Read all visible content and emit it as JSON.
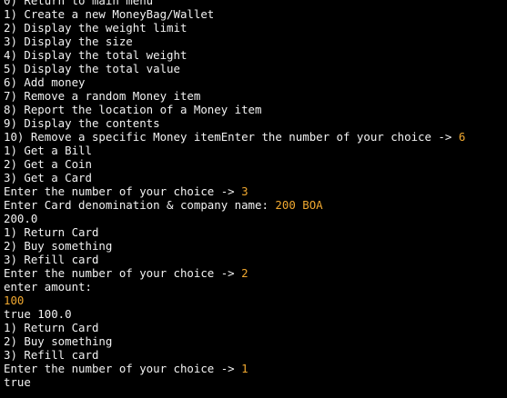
{
  "colors": {
    "background": "#000000",
    "text": "#f2f2f2",
    "user_input": "#f0a830"
  },
  "terminal": {
    "lines": [
      {
        "text": "0) Return to main menu",
        "input": ""
      },
      {
        "text": "1) Create a new MoneyBag/Wallet",
        "input": ""
      },
      {
        "text": "2) Display the weight limit",
        "input": ""
      },
      {
        "text": "3) Display the size",
        "input": ""
      },
      {
        "text": "4) Display the total weight",
        "input": ""
      },
      {
        "text": "5) Display the total value",
        "input": ""
      },
      {
        "text": "6) Add money",
        "input": ""
      },
      {
        "text": "7) Remove a random Money item",
        "input": ""
      },
      {
        "text": "8) Report the location of a Money item",
        "input": ""
      },
      {
        "text": "9) Display the contents",
        "input": ""
      },
      {
        "text": "10) Remove a specific Money itemEnter the number of your choice -> ",
        "input": "6"
      },
      {
        "text": "1) Get a Bill",
        "input": ""
      },
      {
        "text": "2) Get a Coin",
        "input": ""
      },
      {
        "text": "3) Get a Card",
        "input": ""
      },
      {
        "text": "Enter the number of your choice -> ",
        "input": "3"
      },
      {
        "text": "Enter Card denomination & company name: ",
        "input": "200 BOA"
      },
      {
        "text": "200.0",
        "input": ""
      },
      {
        "text": "1) Return Card",
        "input": ""
      },
      {
        "text": "2) Buy something",
        "input": ""
      },
      {
        "text": "3) Refill card",
        "input": ""
      },
      {
        "text": "Enter the number of your choice -> ",
        "input": "2"
      },
      {
        "text": "enter amount:",
        "input": ""
      },
      {
        "text": "",
        "input": "100"
      },
      {
        "text": "true 100.0",
        "input": ""
      },
      {
        "text": "1) Return Card",
        "input": ""
      },
      {
        "text": "2) Buy something",
        "input": ""
      },
      {
        "text": "3) Refill card",
        "input": ""
      },
      {
        "text": "Enter the number of your choice -> ",
        "input": "1"
      },
      {
        "text": "true",
        "input": ""
      }
    ]
  }
}
